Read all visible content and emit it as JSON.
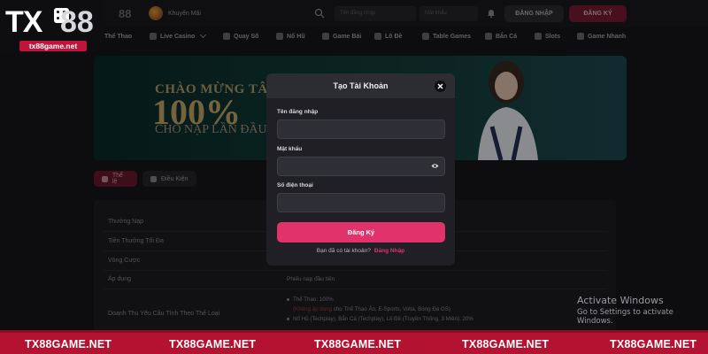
{
  "logo": {
    "brand_tx": "TX",
    "brand_88": "88",
    "domain": "tx88game.net"
  },
  "topbar": {
    "logo_partial": "88",
    "promo_label": "Khuyến Mãi",
    "username_placeholder": "Tên đăng nhập",
    "password_placeholder": "Mật khẩu",
    "login_label": "ĐĂNG NHẬP",
    "register_label": "ĐĂNG KÝ"
  },
  "nav": {
    "items": [
      {
        "label": "Thể Thao",
        "icon": "ball-icon"
      },
      {
        "label": "Live Casino",
        "icon": "casino-chip-icon",
        "dropdown": true
      },
      {
        "label": "Quay Số",
        "icon": "lottery-icon"
      },
      {
        "label": "Nổ Hũ",
        "icon": "slot-jar-icon"
      },
      {
        "label": "Game Bài",
        "icon": "cards-icon"
      },
      {
        "label": "Lô Đề",
        "icon": "number-icon"
      },
      {
        "label": "Table Games",
        "icon": "table-icon"
      },
      {
        "label": "Bắn Cá",
        "icon": "fish-icon"
      },
      {
        "label": "Slots",
        "icon": "slots-icon"
      },
      {
        "label": "Game Nhanh",
        "icon": "rocket-icon"
      }
    ]
  },
  "banner": {
    "title": "CHÀO MỪNG TÂN TH",
    "percent": "100%",
    "subtitle": "CHO NẠP LẦN ĐẦU"
  },
  "tabs": {
    "rules": "Thể lệ",
    "conditions": "Điều Kiện"
  },
  "table": {
    "rows": [
      {
        "label": "Thưởng Nạp",
        "value": ""
      },
      {
        "label": "Tiền Thưởng Tối Đa",
        "value": ""
      },
      {
        "label": "Vòng Cược",
        "value": ""
      },
      {
        "label": "Áp dụng",
        "value": "Phiếu nạp đầu tiên"
      }
    ],
    "multi_row": {
      "label": "Doanh Thu Yêu Cầu Tính Theo Thể Loại",
      "line1": "Thể Thao: 100%",
      "line2_hl": "(Không áp dụng",
      "line2_rest": " cho Thể Thao Ảo, E-Sports, Volta, Bóng Đá GS)",
      "line3": "Nổ Hũ (Techplay), Bắn Cá (Techplay), Lô Đề (Truyền Thống, 3 Miền): 20%"
    }
  },
  "modal": {
    "title": "Tạo Tài Khoản",
    "username_label": "Tên đăng nhập",
    "password_label": "Mật khẩu",
    "phone_label": "Số điện thoại",
    "username_value": "",
    "password_value": "",
    "phone_value": "",
    "submit_label": "Đăng Ký",
    "footer_text": "Bạn đã có tài khoản?",
    "footer_link": "Đăng Nhập"
  },
  "watermark": {
    "title": "Activate Windows",
    "subtitle": "Go to Settings to activate Windows."
  },
  "strip": {
    "labels": [
      "TX88GAME.NET",
      "TX88GAME.NET",
      "TX88GAME.NET",
      "TX88GAME.NET",
      "TX88GAME.NET"
    ]
  },
  "colors": {
    "accent": "#e0336b",
    "strip": "#b31230",
    "logo_domain_bg": "#c0143c"
  }
}
